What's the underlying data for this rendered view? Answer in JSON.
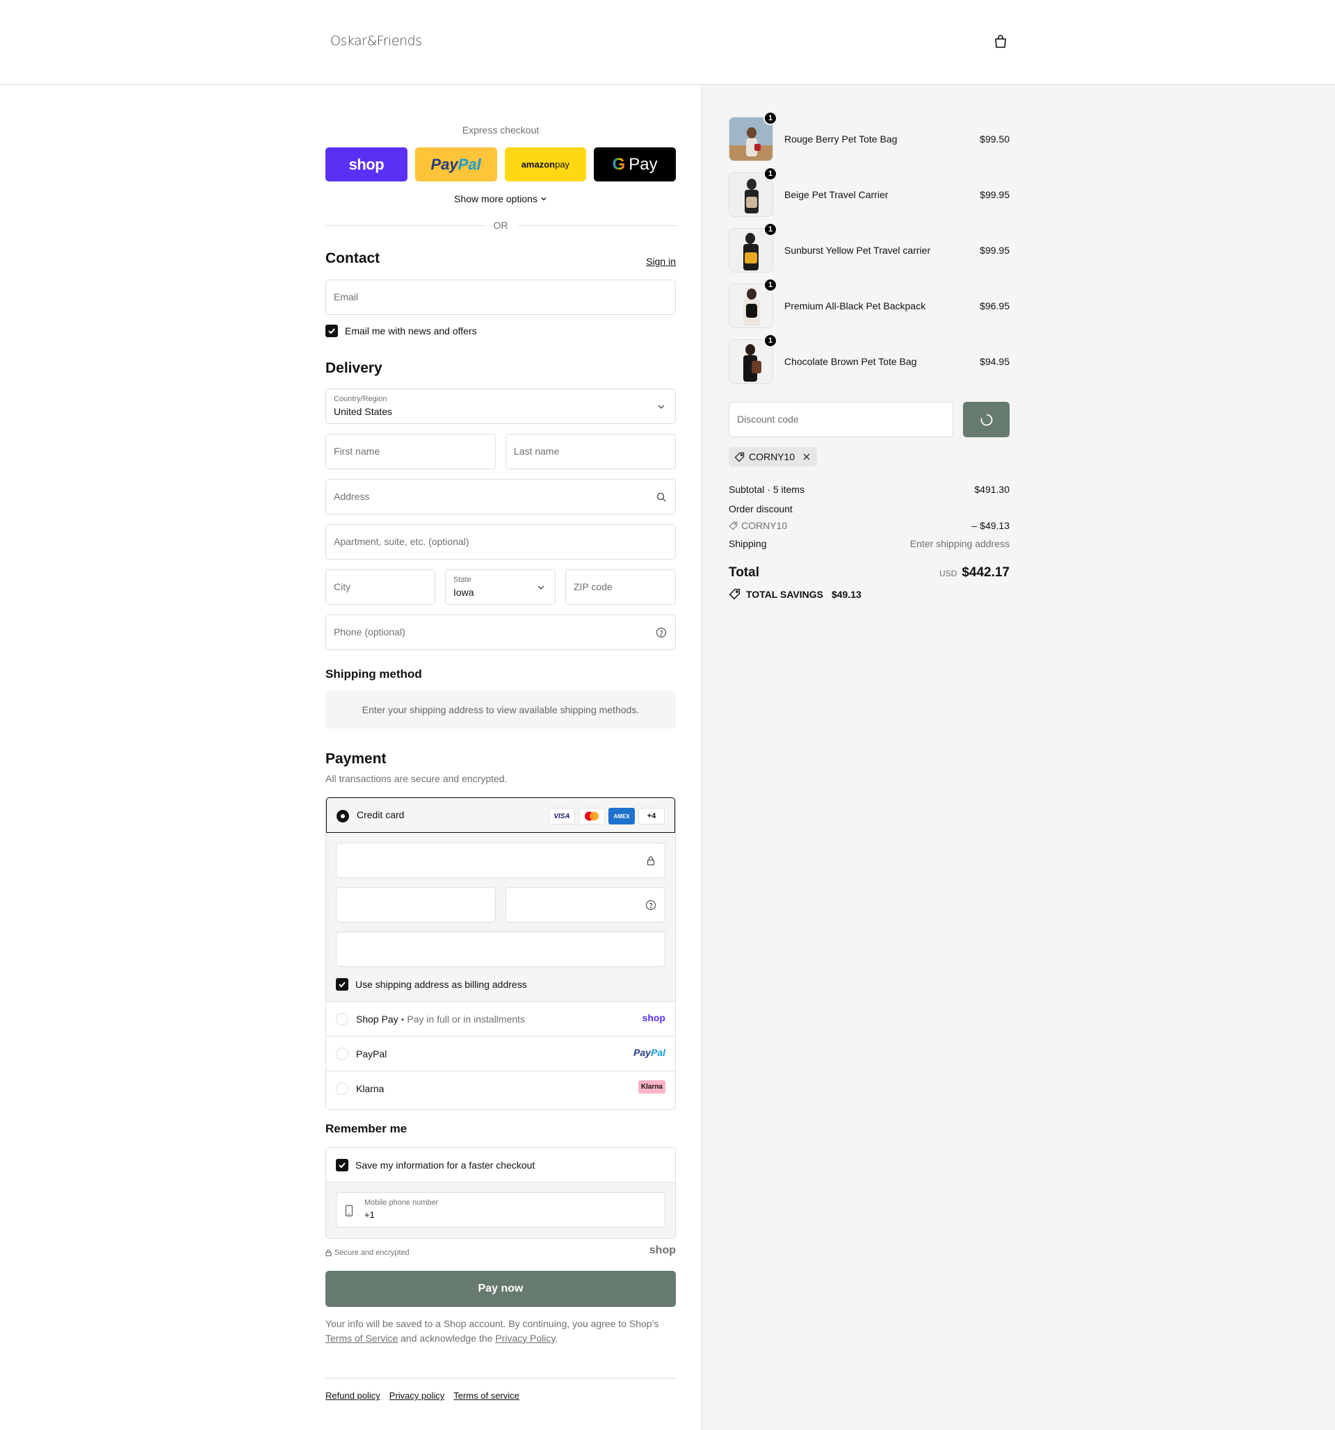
{
  "header": {
    "logo": "Oskar&Friends",
    "cart_icon": "shopping-bag-icon"
  },
  "express": {
    "label": "Express checkout",
    "shop": "shop",
    "paypal_a": "Pay",
    "paypal_b": "Pal",
    "amazon_a": "amazon",
    "amazon_b": " pay",
    "gpay_g": "G",
    "gpay_label": "Pay",
    "more": "Show more options",
    "or": "OR"
  },
  "contact": {
    "title": "Contact",
    "sign_in": "Sign in",
    "email_placeholder": "Email",
    "news_label": "Email me with news and offers"
  },
  "delivery": {
    "title": "Delivery",
    "country_label": "Country/Region",
    "country_value": "United States",
    "first_name": "First name",
    "last_name": "Last name",
    "address": "Address",
    "apartment": "Apartment, suite, etc. (optional)",
    "city": "City",
    "state_label": "State",
    "state_value": "Iowa",
    "zip": "ZIP code",
    "phone": "Phone (optional)"
  },
  "shipping": {
    "title": "Shipping method",
    "note": "Enter your shipping address to view available shipping methods."
  },
  "payment": {
    "title": "Payment",
    "subtitle": "All transactions are secure and encrypted.",
    "credit_card": "Credit card",
    "card_logos": [
      "VISA",
      "",
      "AMEX",
      "+4"
    ],
    "billing_label": "Use shipping address as billing address",
    "shop_pay": "Shop Pay",
    "shop_pay_sub": "Pay in full or in installments",
    "shop_pay_logo": "shop",
    "paypal": "PayPal",
    "paypal_logo_a": "Pay",
    "paypal_logo_b": "Pal",
    "klarna": "Klarna",
    "klarna_logo": "Klarna"
  },
  "remember": {
    "title": "Remember me",
    "save_label": "Save my information for a faster checkout",
    "mobile_label": "Mobile phone number",
    "mobile_value": "+1",
    "secure": "Secure and encrypted",
    "shop_logo": "shop"
  },
  "pay_now": "Pay now",
  "disclaimer": {
    "a": "Your info will be saved to a Shop account. By continuing, you agree to Shop’s ",
    "terms": "Terms of Service",
    "b": " and acknowledge the ",
    "privacy": "Privacy Policy",
    "c": "."
  },
  "footer": {
    "refund": "Refund policy",
    "privacy": "Privacy policy",
    "terms": "Terms of service"
  },
  "order": {
    "items": [
      {
        "name": "Rouge Berry Pet Tote Bag",
        "price": "$99.50",
        "qty": "1"
      },
      {
        "name": "Beige Pet Travel Carrier",
        "price": "$99.95",
        "qty": "1"
      },
      {
        "name": "Sunburst Yellow Pet Travel carrier",
        "price": "$99.95",
        "qty": "1"
      },
      {
        "name": "Premium All-Black Pet Backpack",
        "price": "$96.95",
        "qty": "1"
      },
      {
        "name": "Chocolate Brown Pet Tote Bag",
        "price": "$94.95",
        "qty": "1"
      }
    ],
    "discount_placeholder": "Discount code",
    "applied_code": "CORNY10",
    "subtotal_label": "Subtotal · 5 items",
    "subtotal": "$491.30",
    "order_discount_label": "Order discount",
    "discount_code": "CORNY10",
    "discount_value": "– $49.13",
    "shipping_label": "Shipping",
    "shipping_value": "Enter shipping address",
    "total_label": "Total",
    "currency": "USD",
    "total": "$442.17",
    "savings_label": "TOTAL SAVINGS",
    "savings": "$49.13"
  },
  "colors": {
    "accent": "#667a70",
    "shop": "#5a31f4",
    "paypal": "#ffc439",
    "amazon": "#ffd814"
  }
}
